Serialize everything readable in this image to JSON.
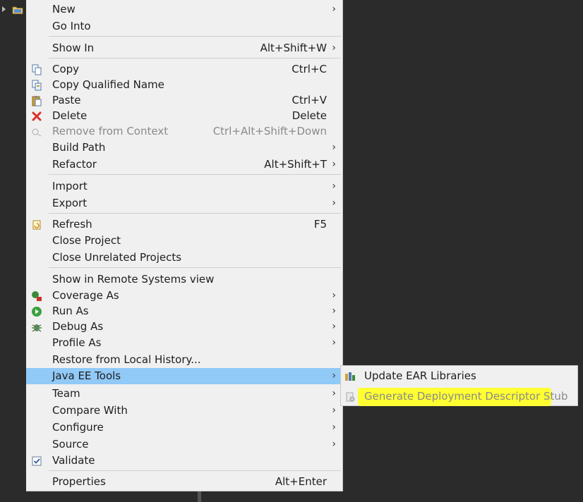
{
  "menu": {
    "items": [
      {
        "label": "New",
        "shortcut": "",
        "arrow": "›"
      },
      {
        "label": "Go Into",
        "shortcut": "",
        "arrow": ""
      },
      {
        "label": "Show In",
        "shortcut": "Alt+Shift+W",
        "arrow": "›"
      },
      {
        "label": "Copy",
        "shortcut": "Ctrl+C",
        "arrow": ""
      },
      {
        "label": "Copy Qualified Name",
        "shortcut": "",
        "arrow": ""
      },
      {
        "label": "Paste",
        "shortcut": "Ctrl+V",
        "arrow": ""
      },
      {
        "label": "Delete",
        "shortcut": "Delete",
        "arrow": ""
      },
      {
        "label": "Remove from Context",
        "shortcut": "Ctrl+Alt+Shift+Down",
        "arrow": ""
      },
      {
        "label": "Build Path",
        "shortcut": "",
        "arrow": "›"
      },
      {
        "label": "Refactor",
        "shortcut": "Alt+Shift+T",
        "arrow": "›"
      },
      {
        "label": "Import",
        "shortcut": "",
        "arrow": "›"
      },
      {
        "label": "Export",
        "shortcut": "",
        "arrow": "›"
      },
      {
        "label": "Refresh",
        "shortcut": "F5",
        "arrow": ""
      },
      {
        "label": "Close Project",
        "shortcut": "",
        "arrow": ""
      },
      {
        "label": "Close Unrelated Projects",
        "shortcut": "",
        "arrow": ""
      },
      {
        "label": "Show in Remote Systems view",
        "shortcut": "",
        "arrow": ""
      },
      {
        "label": "Coverage As",
        "shortcut": "",
        "arrow": "›"
      },
      {
        "label": "Run As",
        "shortcut": "",
        "arrow": "›"
      },
      {
        "label": "Debug As",
        "shortcut": "",
        "arrow": "›"
      },
      {
        "label": "Profile As",
        "shortcut": "",
        "arrow": "›"
      },
      {
        "label": "Restore from Local History...",
        "shortcut": "",
        "arrow": ""
      },
      {
        "label": "Java EE Tools",
        "shortcut": "",
        "arrow": "›"
      },
      {
        "label": "Team",
        "shortcut": "",
        "arrow": "›"
      },
      {
        "label": "Compare With",
        "shortcut": "",
        "arrow": "›"
      },
      {
        "label": "Configure",
        "shortcut": "",
        "arrow": "›"
      },
      {
        "label": "Source",
        "shortcut": "",
        "arrow": "›"
      },
      {
        "label": "Validate",
        "shortcut": "",
        "arrow": ""
      },
      {
        "label": "Properties",
        "shortcut": "Alt+Enter",
        "arrow": ""
      }
    ]
  },
  "submenu": {
    "items": [
      {
        "label": "Update EAR Libraries"
      },
      {
        "label": "Generate Deployment Descriptor Stub"
      }
    ],
    "highlight_color": "#ffff32"
  },
  "colors": {
    "menu_bg": "#f0f0f0",
    "active_bg": "#91c9f7",
    "background": "#2b2b2b",
    "disabled_text": "#8a8a8a"
  },
  "icons": [
    "folder-icon",
    "copy-icon",
    "copy-qualified-name-icon",
    "paste-icon",
    "delete-icon",
    "remove-context-icon",
    "refresh-icon",
    "coverage-icon",
    "run-icon",
    "debug-icon",
    "validate-check-icon",
    "ear-libraries-icon",
    "deployment-descriptor-icon"
  ]
}
